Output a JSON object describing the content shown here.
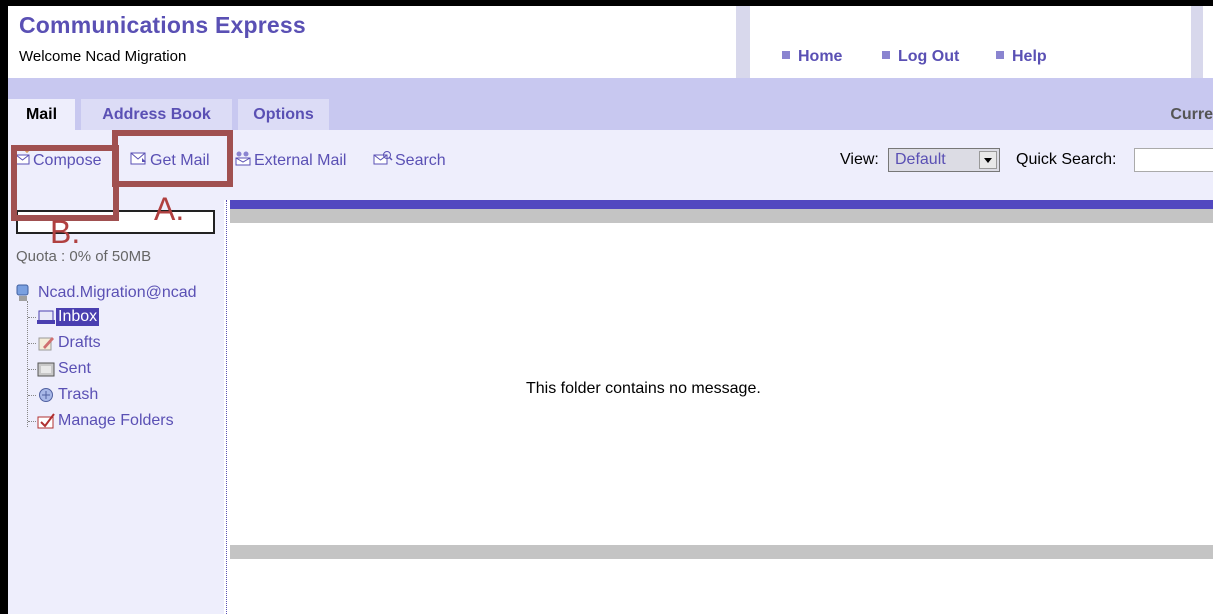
{
  "header": {
    "app_title": "Communications Express",
    "welcome": "Welcome Ncad Migration",
    "nav": [
      {
        "label": "Home"
      },
      {
        "label": "Log Out"
      },
      {
        "label": "Help"
      }
    ]
  },
  "tabs": [
    {
      "label": "Mail",
      "active": true
    },
    {
      "label": "Address Book",
      "active": false
    },
    {
      "label": "Options",
      "active": false
    }
  ],
  "current_label": "Curre",
  "toolbar": {
    "compose": "Compose",
    "get_mail": "Get Mail",
    "external_mail": "External Mail",
    "search": "Search",
    "view_label": "View:",
    "view_value": "Default",
    "quick_search_label": "Quick Search:",
    "quick_search_value": ""
  },
  "sidebar": {
    "quota": "Quota : 0% of 50MB",
    "account": "Ncad.Migration@ncad",
    "folders": [
      {
        "label": "Inbox",
        "icon": "inbox-icon",
        "selected": true
      },
      {
        "label": "Drafts",
        "icon": "drafts-icon",
        "selected": false
      },
      {
        "label": "Sent",
        "icon": "sent-icon",
        "selected": false
      },
      {
        "label": "Trash",
        "icon": "trash-icon",
        "selected": false
      },
      {
        "label": "Manage Folders",
        "icon": "manage-folders-icon",
        "selected": false
      }
    ]
  },
  "content": {
    "empty_message": "This folder contains no message."
  },
  "annotations": {
    "a": "A.",
    "b": "B."
  },
  "colors": {
    "accent": "#5a50b4",
    "annotation": "#a05050",
    "tabbar": "#c8c8f0",
    "panel": "#eeeefc",
    "selected": "#4a3fb0"
  }
}
